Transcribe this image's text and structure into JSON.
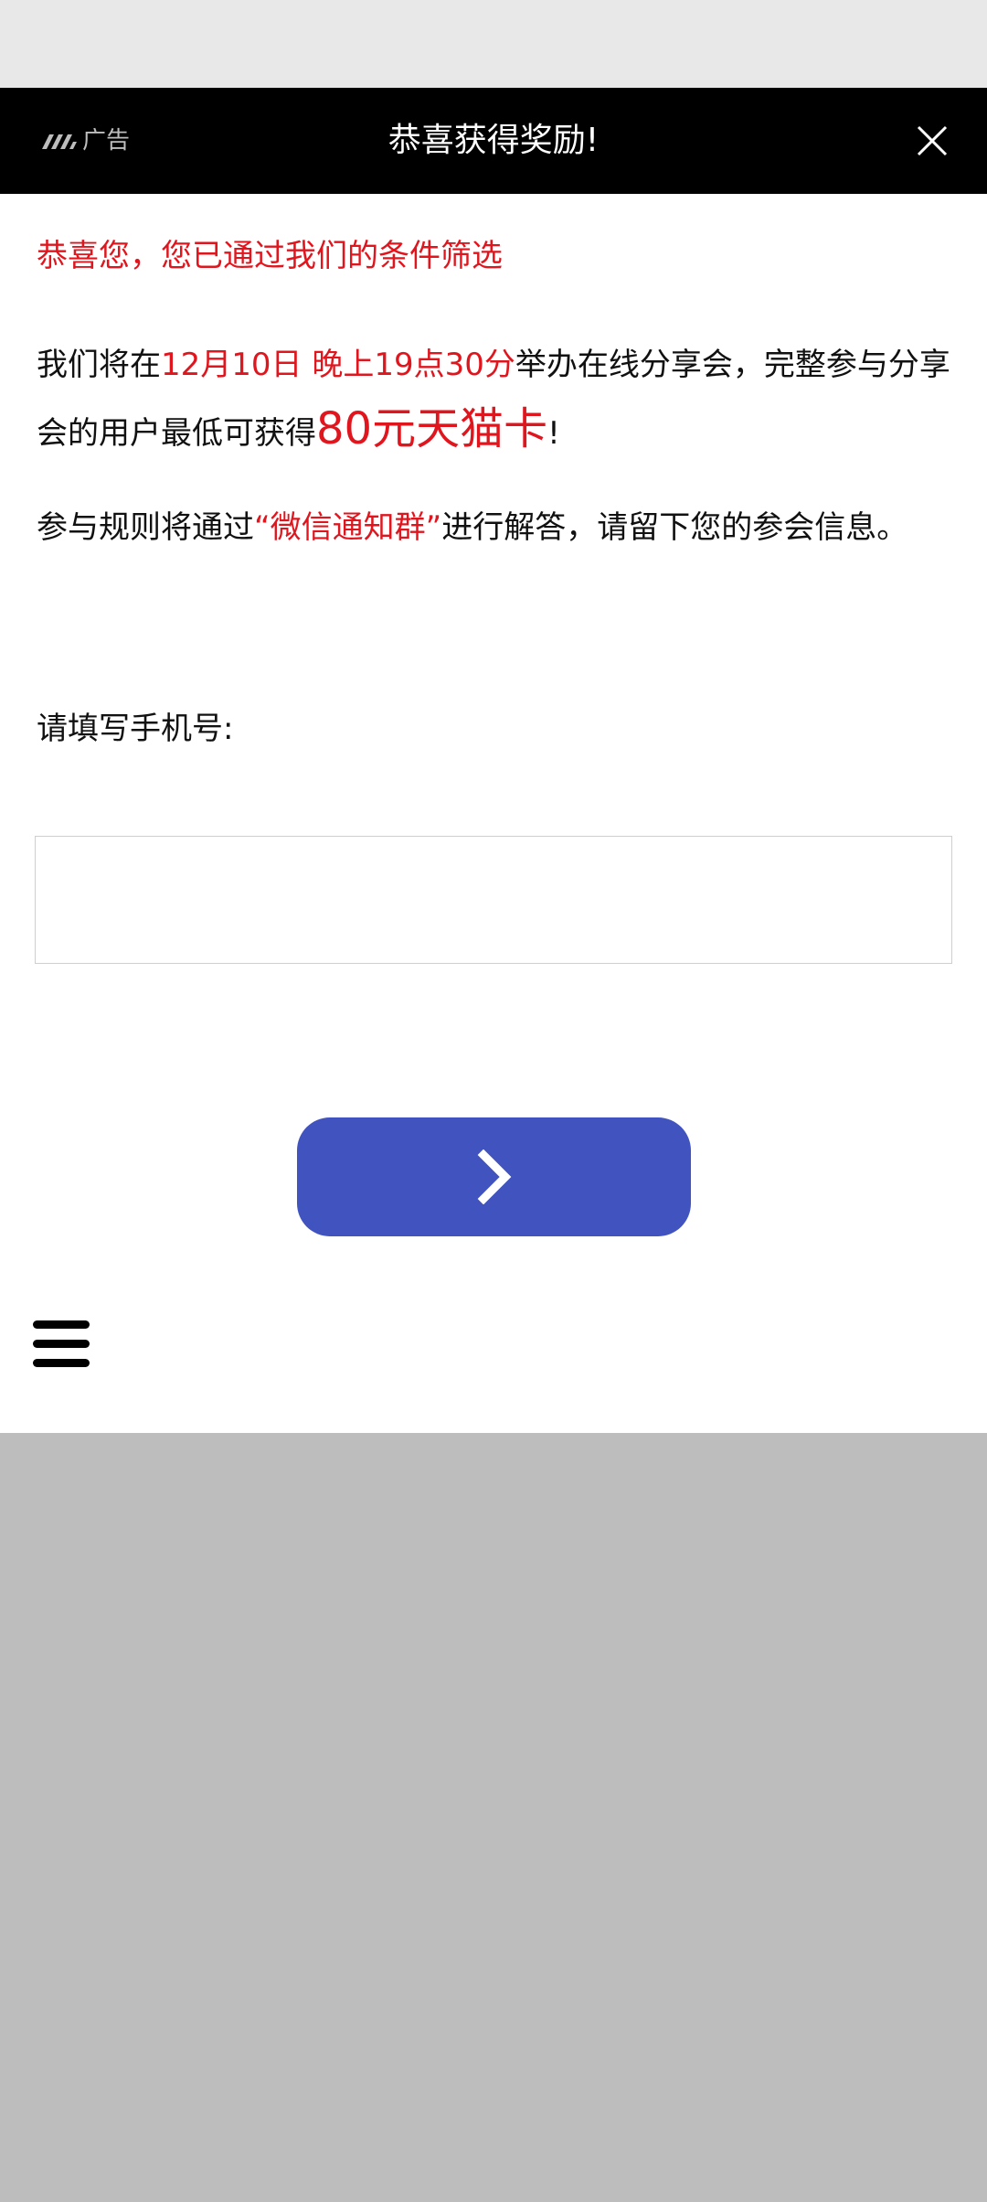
{
  "topbar": {
    "ad_label": "广告",
    "title": "恭喜获得奖励!",
    "close_icon": "close-icon",
    "background": "#000000"
  },
  "content": {
    "headline": "恭喜您，您已通过我们的条件筛选",
    "intro_prefix": "我们将在",
    "intro_datetime": "12月10日 晚上19点30分",
    "intro_middle": "举办在线分享会，完整参与分享会的用户最低可获得",
    "intro_reward": "80元天猫卡",
    "intro_suffix": "!",
    "rules_prefix": "参与规则将通过",
    "rules_channel": "“微信通知群”",
    "rules_suffix": "进行解答，请留下您的参会信息。"
  },
  "form": {
    "phone_label": "请填写手机号:",
    "phone_value": "",
    "phone_placeholder": "",
    "submit_icon": "chevron-right-icon"
  },
  "menu": {
    "icon": "hamburger-menu-icon"
  },
  "colors": {
    "accent_red": "#e0161e",
    "button_blue": "#4153bf"
  }
}
